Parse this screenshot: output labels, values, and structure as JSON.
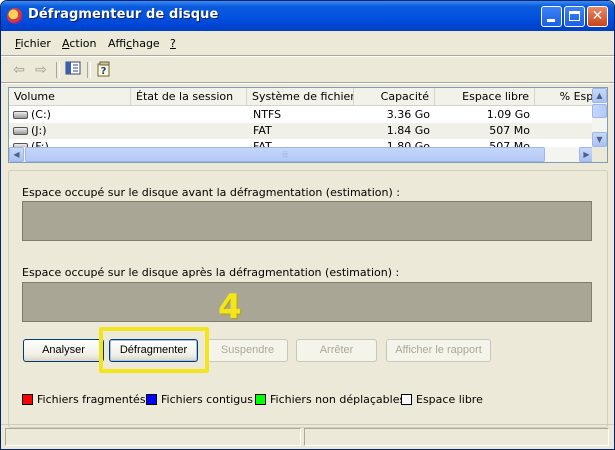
{
  "window": {
    "title": "Défragmenteur de disque"
  },
  "menu": {
    "fichier": {
      "u": "F",
      "rest": "ichier"
    },
    "action": {
      "u": "A",
      "rest": "ction"
    },
    "affichage": {
      "pre": "Affi",
      "u": "c",
      "rest": "hage"
    },
    "help": {
      "u": "?"
    }
  },
  "toolbar": {
    "icons": [
      "back-arrow-icon",
      "forward-arrow-icon",
      "console-tree-icon",
      "help-icon"
    ]
  },
  "volumes": {
    "columns": [
      "Volume",
      "État de la session",
      "Système de fichiers",
      "Capacité",
      "Espace libre",
      "% Espa"
    ],
    "rows": [
      {
        "volume": "(C:)",
        "state": "",
        "fs": "NTFS",
        "capacity": "3.36 Go",
        "free": "1.09 Go"
      },
      {
        "volume": "(J:)",
        "state": "",
        "fs": "FAT",
        "capacity": "1.84 Go",
        "free": "507 Mo"
      }
    ],
    "partial_row": {
      "volume": "(F:)",
      "fs": "FAT",
      "capacity": "1.80 Go",
      "free": "507 Mo"
    }
  },
  "analysis": {
    "before_label": "Espace occupé sur le disque avant la défragmentation (estimation) :",
    "after_label": "Espace occupé sur le disque après la défragmentation (estimation) :"
  },
  "buttons": {
    "analyze": "Analyser",
    "defragment": "Défragmenter",
    "pause": "Suspendre",
    "stop": "Arrêter",
    "report": "Afficher le rapport"
  },
  "annotation": {
    "step": "4",
    "color": "#f2e51e"
  },
  "legend": [
    {
      "label": "Fichiers fragmentés",
      "color": "#ff0000"
    },
    {
      "label": "Fichiers contigus",
      "color": "#0000ff"
    },
    {
      "label": "Fichiers non déplaçables",
      "color": "#00ff00"
    },
    {
      "label": "Espace libre",
      "color": "#ffffff"
    }
  ]
}
